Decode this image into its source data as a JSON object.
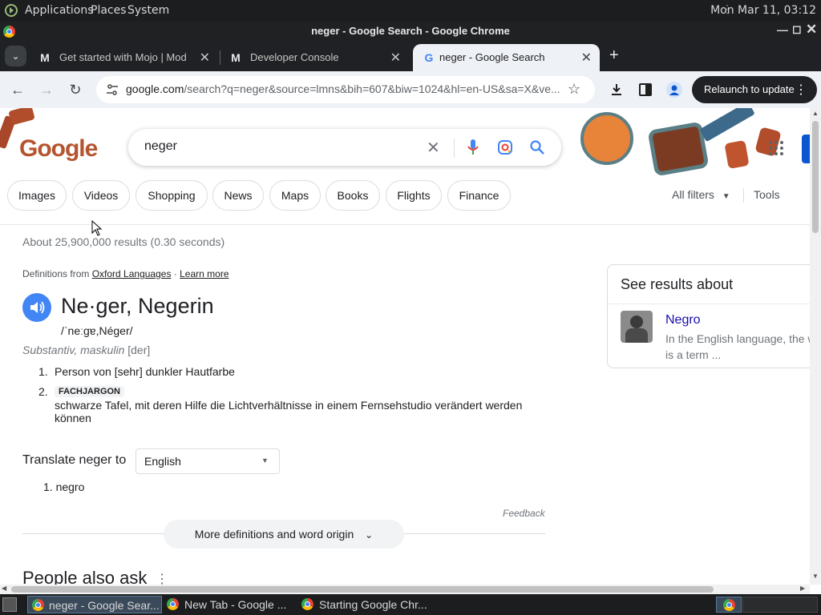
{
  "system_panel": {
    "menus": [
      "Applications",
      "Places",
      "System"
    ],
    "clock": "Mon Mar 11, 03:12"
  },
  "window": {
    "title": "neger - Google Search - Google Chrome"
  },
  "tabs": [
    {
      "label": "Get started with Mojo  | Mod",
      "favicon": "M"
    },
    {
      "label": "Developer Console",
      "favicon": "M"
    },
    {
      "label": "neger - Google Search",
      "favicon": "G"
    }
  ],
  "toolbar": {
    "url_host": "google.com",
    "url_rest": "/search?q=neger&source=lmns&bih=607&biw=1024&hl=en-US&sa=X&ve...",
    "relaunch_label": "Relaunch to update"
  },
  "search": {
    "query": "neger",
    "logo": "Google"
  },
  "filters": [
    "Images",
    "Videos",
    "Shopping",
    "News",
    "Maps",
    "Books",
    "Flights",
    "Finance"
  ],
  "filter_tools": {
    "all_filters": "All filters",
    "tools": "Tools"
  },
  "results": {
    "stats": "About 25,900,000 results (0.30 seconds)"
  },
  "dictionary": {
    "source_prefix": "Definitions from ",
    "source": "Oxford Languages",
    "separator": " · ",
    "learn_more": "Learn more",
    "headword": "Ne·ger, Negerin",
    "pronunciation": "/ˈneːɡɐ,Néger/",
    "pos": "Substantiv, maskulin",
    "gender": "[der]",
    "definitions": [
      {
        "number": "1.",
        "tag": "",
        "text": "Person von [sehr] dunkler Hautfarbe"
      },
      {
        "number": "2.",
        "tag": "FACHJARGON",
        "text": "schwarze Tafel, mit deren Hilfe die Lichtverhältnisse in einem Fernsehstudio verändert werden können"
      }
    ],
    "translate_label": "Translate neger to",
    "translate_language": "English",
    "translation": "1. negro",
    "feedback": "Feedback",
    "more_definitions": "More definitions and word origin"
  },
  "people_also_ask": "People also ask",
  "side_panel": {
    "header": "See results about",
    "title": "Negro",
    "snippet": "In the English language, the w is a term ..."
  },
  "taskbar": {
    "items": [
      "neger - Google Sear...",
      "New Tab - Google ...",
      "Starting Google Chr..."
    ]
  },
  "colors": {
    "link_blue": "#1a0dab",
    "accent_blue": "#4285f4",
    "dark_ui": "#202124"
  }
}
